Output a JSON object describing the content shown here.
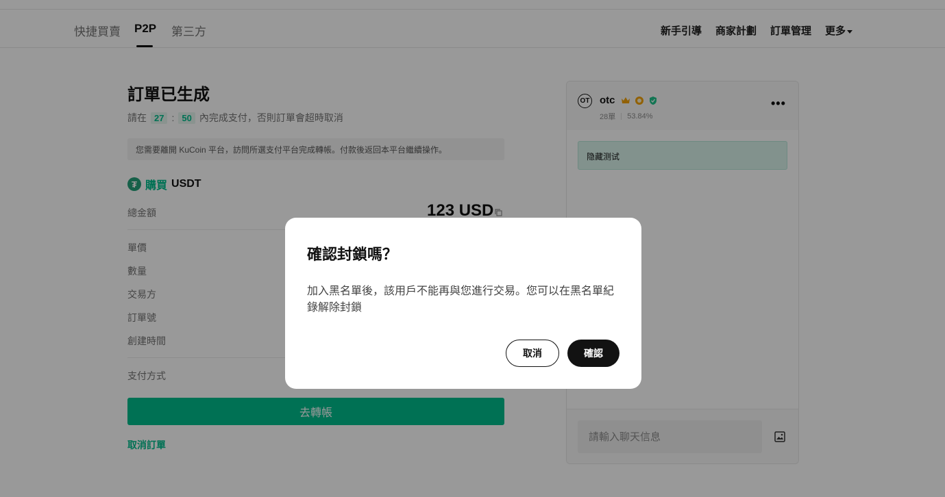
{
  "nav": {
    "tabs": [
      {
        "label": "快捷買賣",
        "active": false
      },
      {
        "label": "P2P",
        "active": true
      },
      {
        "label": "第三方",
        "active": false
      }
    ],
    "links": [
      "新手引導",
      "商家計劃",
      "訂單管理",
      "更多"
    ]
  },
  "order": {
    "title": "訂單已生成",
    "timer_prefix": "請在",
    "minutes": "27",
    "colon": ":",
    "seconds": "50",
    "timer_suffix": "內完成支付，否則訂單會超時取消",
    "notice": "您需要離開 KuCoin 平台，訪問所選支付平台完成轉帳。付款後返回本平台繼續操作。",
    "buy_word": "購買",
    "coin": "USDT",
    "total_label": "總金額",
    "total_value": "123 USD",
    "labels": [
      "單價",
      "數量",
      "交易方",
      "訂單號",
      "創建時間"
    ],
    "payment_method_label": "支付方式",
    "transfer_button": "去轉帳",
    "cancel_order": "取消訂單"
  },
  "chat": {
    "avatar": "OT",
    "merchant": "otc",
    "orders": "28單",
    "rate": "53.84%",
    "message": "隐藏测试",
    "input_placeholder": "請輸入聊天信息",
    "icons": [
      "crown-icon",
      "gold-medal-icon",
      "shield-icon",
      "more-icon",
      "image-icon"
    ]
  },
  "dialog": {
    "title": "確認封鎖嗎？",
    "body": "加入黑名單後，該用戶不能再與您進行交易。您可以在黑名單紀錄解除封鎖",
    "cancel": "取消",
    "confirm": "確認"
  },
  "colors": {
    "accent": "#01bc8d",
    "dark": "#121212",
    "overlay": "rgba(0,0,0,0.40)"
  }
}
